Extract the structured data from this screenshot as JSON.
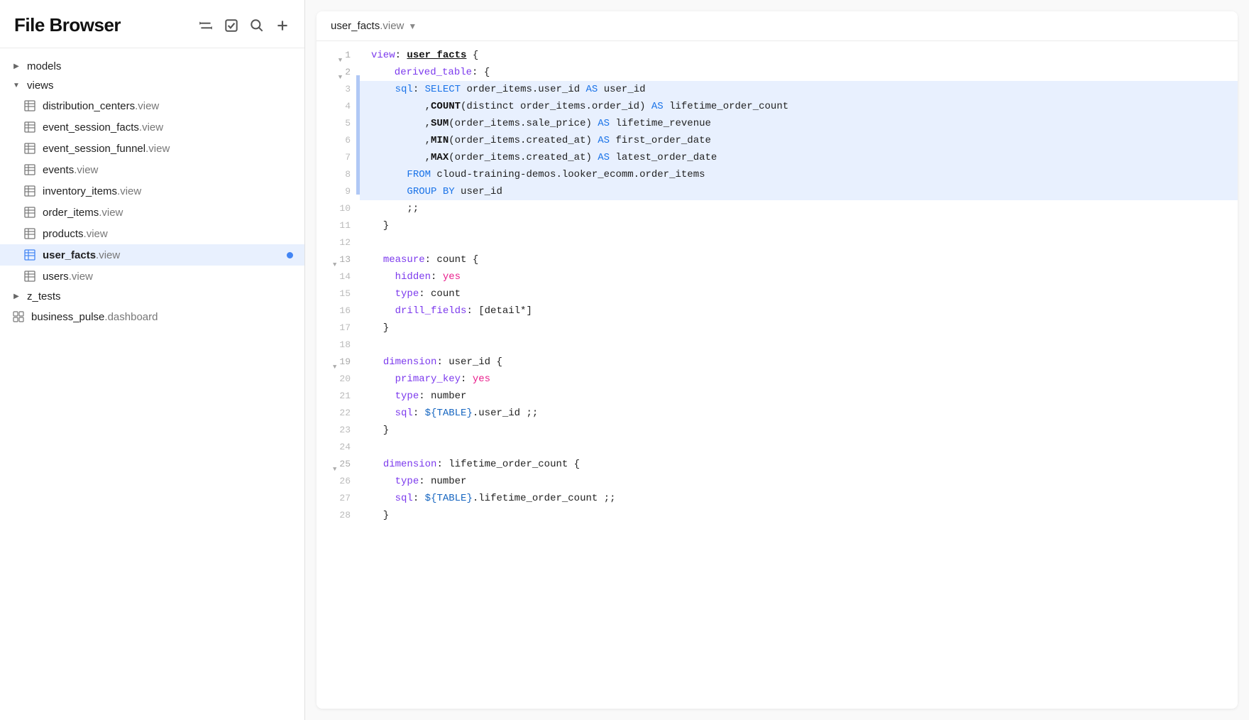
{
  "sidebar": {
    "title": "File Browser",
    "actions": [
      "collapse-icon",
      "checkbox-icon",
      "search-icon",
      "add-icon"
    ],
    "tree": [
      {
        "id": "models",
        "label": "models",
        "type": "folder",
        "indent": 0,
        "expanded": false
      },
      {
        "id": "views",
        "label": "views",
        "type": "folder",
        "indent": 0,
        "expanded": true
      },
      {
        "id": "distribution_centers",
        "label": "distribution_centers",
        "ext": ".view",
        "type": "view",
        "indent": 2
      },
      {
        "id": "event_session_facts",
        "label": "event_session_facts",
        "ext": ".view",
        "type": "view",
        "indent": 2
      },
      {
        "id": "event_session_funnel",
        "label": "event_session_funnel",
        "ext": ".view",
        "type": "view",
        "indent": 2
      },
      {
        "id": "events",
        "label": "events",
        "ext": ".view",
        "type": "view",
        "indent": 2
      },
      {
        "id": "inventory_items",
        "label": "inventory_items",
        "ext": ".view",
        "type": "view",
        "indent": 2
      },
      {
        "id": "order_items",
        "label": "order_items",
        "ext": ".view",
        "type": "view",
        "indent": 2
      },
      {
        "id": "products",
        "label": "products",
        "ext": ".view",
        "type": "view",
        "indent": 2
      },
      {
        "id": "user_facts",
        "label": "user_facts",
        "ext": ".view",
        "type": "view",
        "indent": 2,
        "active": true,
        "dot": true
      },
      {
        "id": "users",
        "label": "users",
        "ext": ".view",
        "type": "view",
        "indent": 2
      },
      {
        "id": "z_tests",
        "label": "z_tests",
        "type": "folder",
        "indent": 0,
        "expanded": false
      },
      {
        "id": "business_pulse",
        "label": "business_pulse",
        "ext": ".dashboard",
        "type": "dashboard",
        "indent": 0
      }
    ]
  },
  "editor": {
    "tab": "user_facts.view",
    "lines": [
      {
        "num": 1,
        "arrow": "▼",
        "content": "view: user_facts {",
        "highlight": false
      },
      {
        "num": 2,
        "arrow": "▼",
        "content": "  derived_table: {",
        "highlight": false
      },
      {
        "num": 3,
        "arrow": null,
        "content": "    sql: SELECT order_items.user_id AS user_id",
        "highlight": true
      },
      {
        "num": 4,
        "arrow": null,
        "content": "         ,COUNT(distinct order_items.order_id) AS lifetime_order_count",
        "highlight": true
      },
      {
        "num": 5,
        "arrow": null,
        "content": "         ,SUM(order_items.sale_price) AS lifetime_revenue",
        "highlight": true
      },
      {
        "num": 6,
        "arrow": null,
        "content": "         ,MIN(order_items.created_at) AS first_order_date",
        "highlight": true
      },
      {
        "num": 7,
        "arrow": null,
        "content": "         ,MAX(order_items.created_at) AS latest_order_date",
        "highlight": true
      },
      {
        "num": 8,
        "arrow": null,
        "content": "      FROM cloud-training-demos.looker_ecomm.order_items",
        "highlight": true
      },
      {
        "num": 9,
        "arrow": null,
        "content": "      GROUP BY user_id",
        "highlight": true
      },
      {
        "num": 10,
        "arrow": null,
        "content": "      ;;",
        "highlight": false
      },
      {
        "num": 11,
        "arrow": null,
        "content": "  }",
        "highlight": false
      },
      {
        "num": 12,
        "arrow": null,
        "content": "",
        "highlight": false
      },
      {
        "num": 13,
        "arrow": "▼",
        "content": "  measure: count {",
        "highlight": false
      },
      {
        "num": 14,
        "arrow": null,
        "content": "    hidden: yes",
        "highlight": false
      },
      {
        "num": 15,
        "arrow": null,
        "content": "    type: count",
        "highlight": false
      },
      {
        "num": 16,
        "arrow": null,
        "content": "    drill_fields: [detail*]",
        "highlight": false
      },
      {
        "num": 17,
        "arrow": null,
        "content": "  }",
        "highlight": false
      },
      {
        "num": 18,
        "arrow": null,
        "content": "",
        "highlight": false
      },
      {
        "num": 19,
        "arrow": "▼",
        "content": "  dimension: user_id {",
        "highlight": false
      },
      {
        "num": 20,
        "arrow": null,
        "content": "    primary_key: yes",
        "highlight": false
      },
      {
        "num": 21,
        "arrow": null,
        "content": "    type: number",
        "highlight": false
      },
      {
        "num": 22,
        "arrow": null,
        "content": "    sql: ${TABLE}.user_id ;;",
        "highlight": false
      },
      {
        "num": 23,
        "arrow": null,
        "content": "  }",
        "highlight": false
      },
      {
        "num": 24,
        "arrow": null,
        "content": "",
        "highlight": false
      },
      {
        "num": 25,
        "arrow": "▼",
        "content": "  dimension: lifetime_order_count {",
        "highlight": false
      },
      {
        "num": 26,
        "arrow": null,
        "content": "    type: number",
        "highlight": false
      },
      {
        "num": 27,
        "arrow": null,
        "content": "    sql: ${TABLE}.lifetime_order_count ;;",
        "highlight": false
      },
      {
        "num": 28,
        "arrow": null,
        "content": "  }",
        "highlight": false
      }
    ]
  }
}
